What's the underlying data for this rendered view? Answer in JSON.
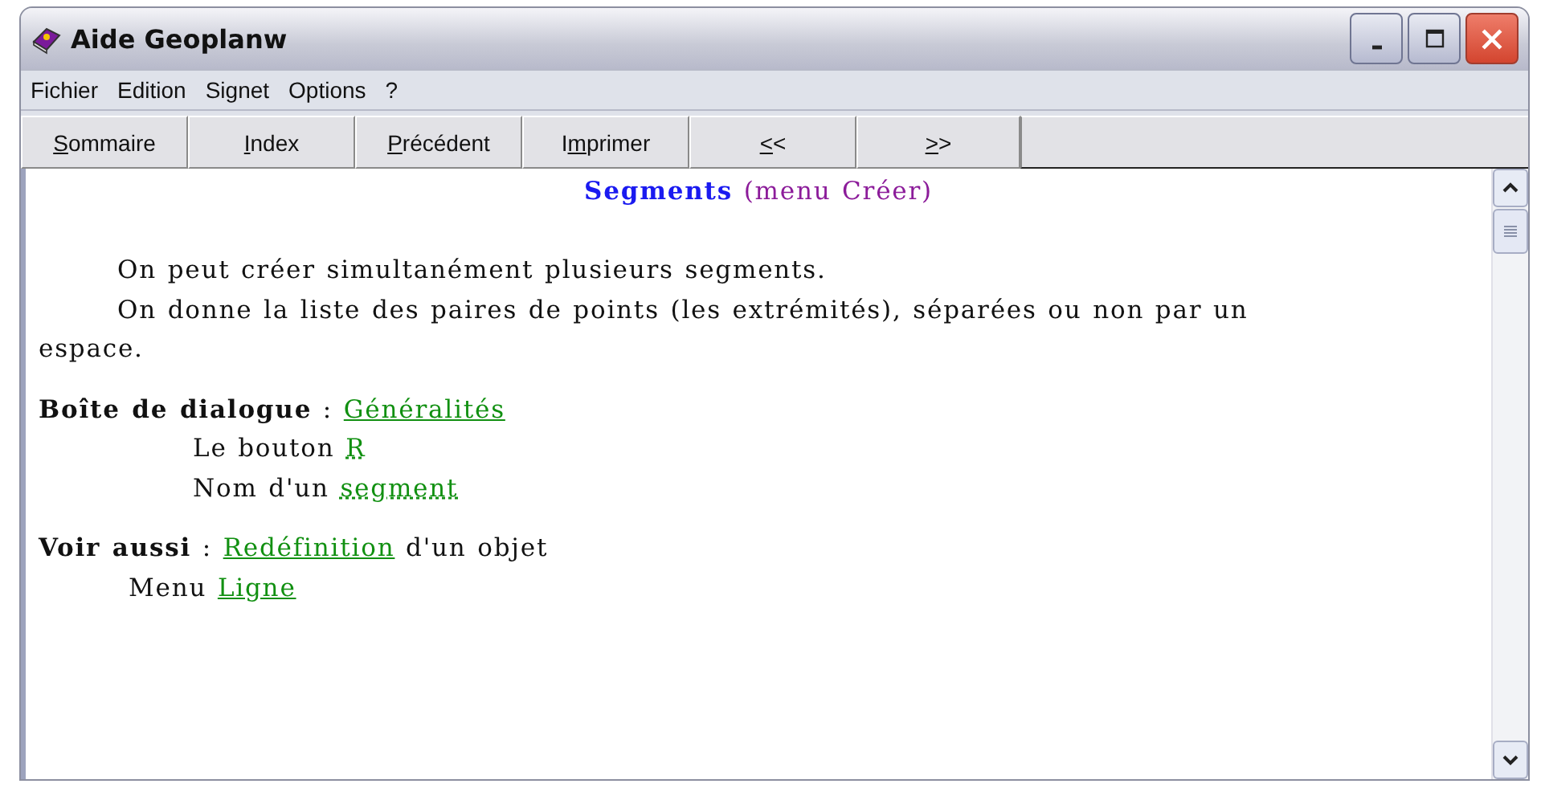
{
  "window": {
    "title": "Aide Geoplanw"
  },
  "menu": [
    "Fichier",
    "Edition",
    "Signet",
    "Options",
    "?"
  ],
  "toolbar": [
    {
      "key": "S",
      "post": "ommaire"
    },
    {
      "key": "I",
      "post": "ndex"
    },
    {
      "key": "P",
      "post": "récédent"
    },
    {
      "pre": "I",
      "key": "m",
      "post": "primer"
    },
    {
      "key": "<",
      "post": "<"
    },
    {
      "key": ">",
      "post": ">"
    }
  ],
  "heading": {
    "title": "Segments",
    "note": "(menu Créer)"
  },
  "lines": [
    {
      "kind": "para",
      "parts": [
        {
          "kind": "text",
          "text": "On peut créer simultanément plusieurs segments."
        }
      ]
    },
    {
      "kind": "para",
      "parts": [
        {
          "kind": "text",
          "text": "On donne la liste des paires de points (les extrémités), séparées ou non par un espace."
        }
      ]
    },
    {
      "kind": "section",
      "parts": [
        {
          "kind": "bold",
          "text": "Boîte de dialogue"
        },
        {
          "kind": "text",
          "text": " : "
        },
        {
          "kind": "link",
          "text": "Généralités"
        }
      ]
    },
    {
      "kind": "sub",
      "parts": [
        {
          "kind": "text",
          "text": "Le bouton "
        },
        {
          "kind": "popup",
          "text": "R"
        }
      ]
    },
    {
      "kind": "sub",
      "parts": [
        {
          "kind": "text",
          "text": "Nom d'un "
        },
        {
          "kind": "popup",
          "text": "segment"
        }
      ]
    },
    {
      "kind": "section",
      "parts": [
        {
          "kind": "bold",
          "text": "Voir aussi"
        },
        {
          "kind": "text",
          "text": " : "
        },
        {
          "kind": "link",
          "text": "Redéfinition"
        },
        {
          "kind": "text",
          "text": " d'un objet"
        }
      ]
    },
    {
      "kind": "menu",
      "parts": [
        {
          "kind": "text",
          "text": "Menu "
        },
        {
          "kind": "link",
          "text": "Ligne"
        }
      ]
    }
  ]
}
